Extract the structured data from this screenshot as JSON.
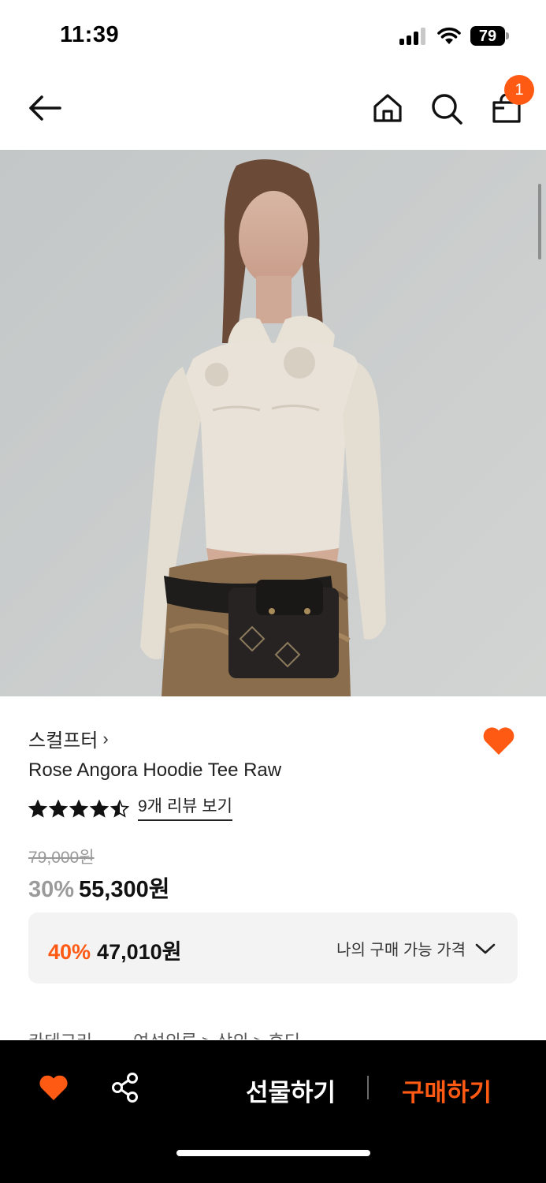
{
  "status_bar": {
    "time": "11:39",
    "battery": "79",
    "icons": [
      "signal-icon",
      "wifi-icon",
      "battery-icon"
    ]
  },
  "header": {
    "icons": [
      "back-arrow-icon",
      "home-icon",
      "search-icon",
      "shopping-bag-icon"
    ],
    "cart_count": "1"
  },
  "product": {
    "brand": "스컬프터",
    "brand_chevron": "›",
    "title": "Rose Angora Hoodie Tee Raw",
    "rating": 4.5,
    "review_link": "9개 리뷰 보기",
    "original_price": "79,000원",
    "discount_percent": "30%",
    "sale_price": "55,300원",
    "liked": true
  },
  "my_price": {
    "percent": "40%",
    "price": "47,010원",
    "label": "나의 구매 가능 가격"
  },
  "category": {
    "label": "카테고리",
    "path": "여성의류 > 상의 > 후디"
  },
  "bottom_bar": {
    "gift_label": "선물하기",
    "buy_label": "구매하기"
  },
  "colors": {
    "accent": "#ff5a14",
    "text": "#111111",
    "muted": "#999999",
    "bottom_bar": "#000000",
    "price_box": "#f3f3f3"
  }
}
